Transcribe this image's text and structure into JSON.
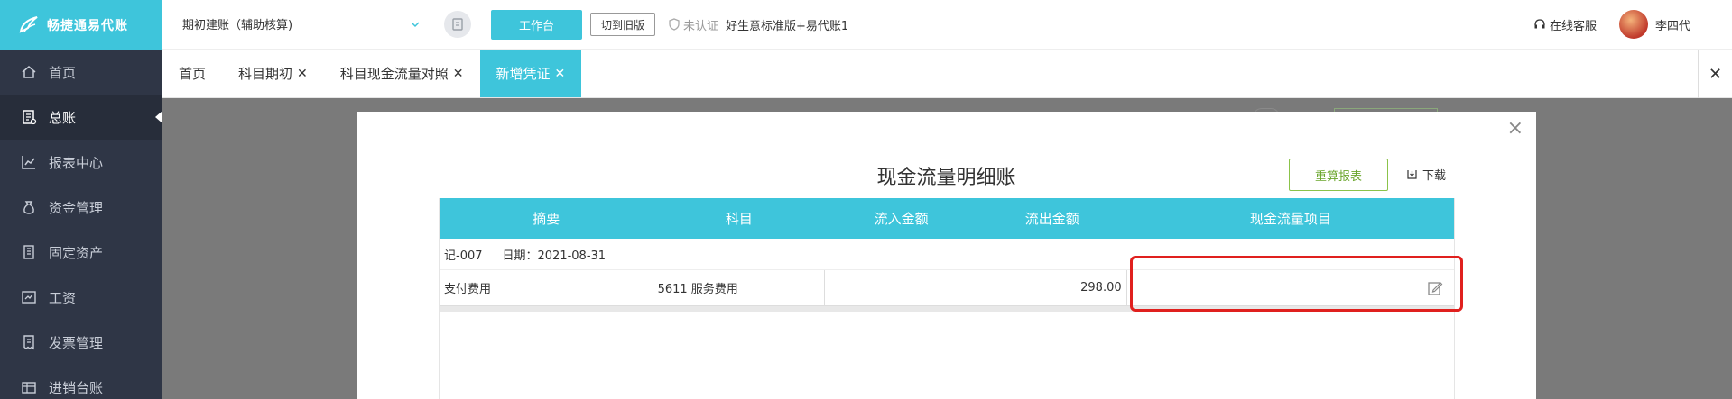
{
  "app": {
    "logo_text": "畅捷通易代账"
  },
  "sidebar": {
    "items": [
      {
        "label": "首页",
        "icon": "home-icon"
      },
      {
        "label": "总账",
        "icon": "ledger-icon",
        "active": true
      },
      {
        "label": "报表中心",
        "icon": "chart-icon"
      },
      {
        "label": "资金管理",
        "icon": "money-bag-icon"
      },
      {
        "label": "固定资产",
        "icon": "building-icon"
      },
      {
        "label": "工资",
        "icon": "salary-icon"
      },
      {
        "label": "发票管理",
        "icon": "invoice-icon"
      },
      {
        "label": "进销台账",
        "icon": "stock-icon"
      }
    ]
  },
  "header": {
    "company": "期初建账（辅助核算)",
    "workbench_label": "工作台",
    "old_version_label": "切到旧版",
    "unverified_label": "未认证",
    "version_label": "好生意标准版+易代账1",
    "support_label": "在线客服",
    "user_name": "李四代"
  },
  "tabs": [
    {
      "label": "首页",
      "closable": false
    },
    {
      "label": "科目期初",
      "closable": true
    },
    {
      "label": "科目现金流量对照",
      "closable": true
    },
    {
      "label": "新增凭证",
      "closable": true,
      "active": true
    }
  ],
  "modal": {
    "title": "现金流量明细账",
    "recalc_label": "重算报表",
    "download_label": "下载",
    "columns": [
      "摘要",
      "科目",
      "流入金额",
      "流出金额",
      "现金流量项目"
    ],
    "voucher": {
      "no": "记-007",
      "date_label": "日期：2021-08-31"
    },
    "rows": [
      {
        "summary": "支付费用",
        "account": "5611 服务费用",
        "inflow": "",
        "outflow": "298.00",
        "cashflow_item": ""
      }
    ]
  },
  "colors": {
    "accent": "#3ec5db",
    "sidebar_bg": "#2f3646",
    "highlight": "#e0201e",
    "recalc_green": "#6aa62c"
  }
}
